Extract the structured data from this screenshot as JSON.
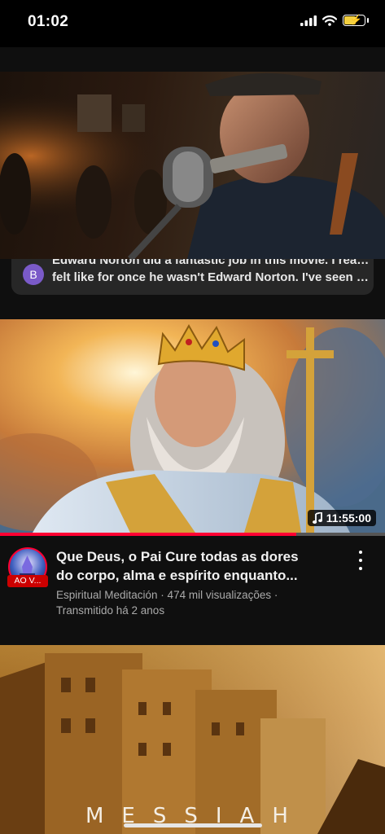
{
  "status_bar": {
    "time": "01:02"
  },
  "comment_preview": {
    "avatar_letter": "B",
    "line1": "Edward Norton did a fantastic job in this movie. I really",
    "line2": "felt like for once he wasn't Edward Norton. I've seen m..."
  },
  "video": {
    "duration": "11:55:00",
    "progress_fraction": 0.77,
    "channel_badge": "AO V...",
    "title_line1": "Que Deus, o Pai Cure todas as dores",
    "title_line2": "do corpo, alma e espírito enquanto...",
    "meta_line1": "Espiritual Meditación · 474 mil visualizações ·",
    "meta_line2": "Transmitido há 2 anos"
  },
  "next_video": {
    "thumbnail_text": "MESSIAH"
  },
  "colors": {
    "accent": "#ff0033",
    "background": "#0f0f0f"
  }
}
